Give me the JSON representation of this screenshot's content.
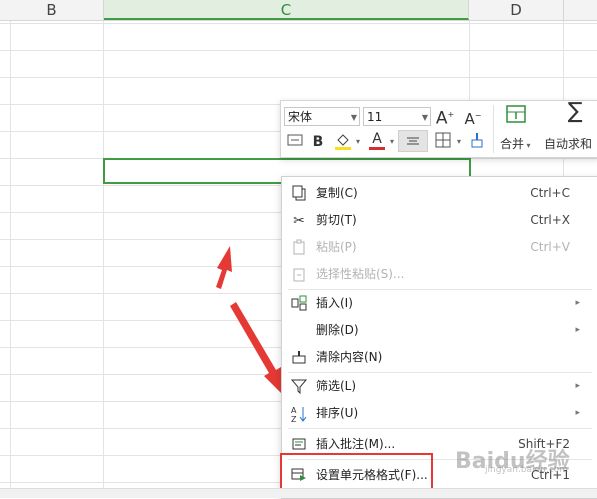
{
  "columns": {
    "b": "B",
    "c": "C",
    "d": "D"
  },
  "toolbar": {
    "font_name": "宋体",
    "font_size": "11",
    "grow_font": "A",
    "shrink_font": "A",
    "bold": "B",
    "font_color_letter": "A",
    "merge_label": "合并",
    "autosum_label": "自动求和",
    "sigma": "∑"
  },
  "menu": {
    "copy": {
      "label": "复制(C)",
      "shortcut": "Ctrl+C"
    },
    "cut": {
      "label": "剪切(T)",
      "shortcut": "Ctrl+X"
    },
    "paste": {
      "label": "粘贴(P)",
      "shortcut": "Ctrl+V"
    },
    "paste_special": {
      "label": "选择性粘贴(S)..."
    },
    "insert": {
      "label": "插入(I)"
    },
    "delete": {
      "label": "删除(D)"
    },
    "clear": {
      "label": "清除内容(N)"
    },
    "filter": {
      "label": "筛选(L)"
    },
    "sort": {
      "label": "排序(U)"
    },
    "insert_comment": {
      "label": "插入批注(M)...",
      "shortcut": "Shift+F2"
    },
    "format_cells": {
      "label": "设置单元格格式(F)...",
      "shortcut": "Ctrl+1"
    },
    "submenu_arrow": "▸"
  },
  "watermark": {
    "brand": "Baidu经验",
    "url": "jingyan.baidu.com"
  },
  "colors": {
    "accent_green": "#3f9b45",
    "arrow_red": "#e53935"
  }
}
